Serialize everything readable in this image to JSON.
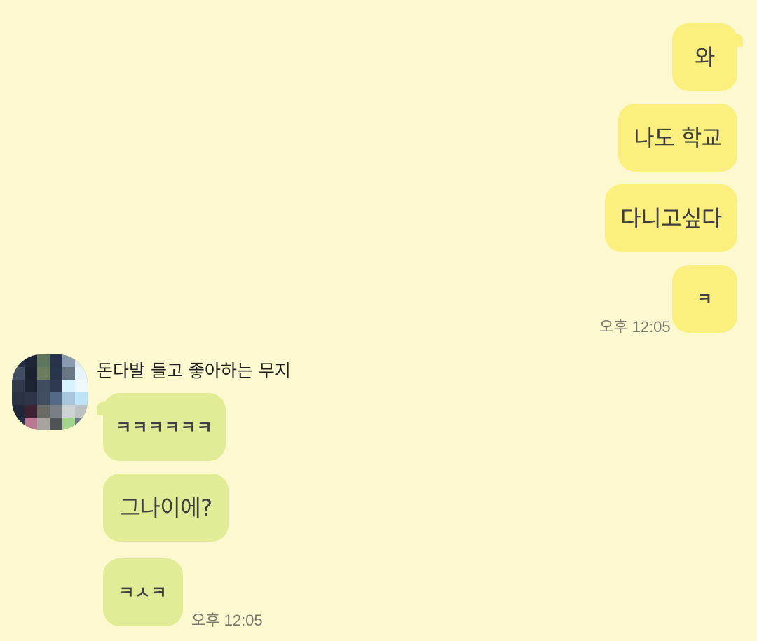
{
  "colors": {
    "background": "#fcf8cf",
    "my_bubble": "#fbef7d",
    "their_bubble": "#e2ec97",
    "text": "#3f3f3f",
    "timestamp": "#7b7a70"
  },
  "sent_messages": [
    {
      "text": "와"
    },
    {
      "text": "나도 학교"
    },
    {
      "text": "다니고싶다"
    },
    {
      "text": "ㅋ"
    }
  ],
  "sent_timestamp": "오후 12:05",
  "sender": {
    "name": "돈다발 들고 좋아하는 무지",
    "avatar_icon": "pixelated-profile-avatar"
  },
  "received_messages": [
    {
      "text": "ㅋㅋㅋㅋㅋㅋ"
    },
    {
      "text": "그나이에?"
    },
    {
      "text": "ㅋㅅㅋ"
    }
  ],
  "received_timestamp": "오후 12:05"
}
